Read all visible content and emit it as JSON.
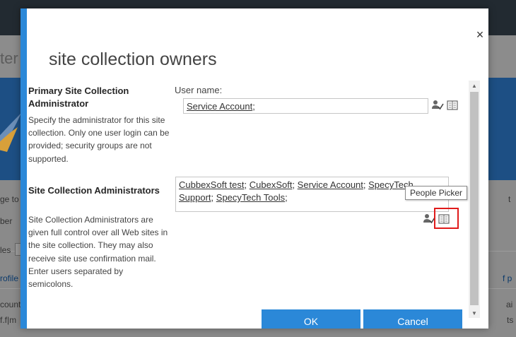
{
  "background": {
    "title_fragment": "ter",
    "fragments": [
      {
        "name": "bg-fragment-ge-to",
        "text": "ge to"
      },
      {
        "name": "bg-fragment-ber",
        "text": "ber"
      },
      {
        "name": "bg-fragment-les",
        "text": "les"
      },
      {
        "name": "bg-fragment-rofile",
        "text": "rofile"
      },
      {
        "name": "bg-fragment-ccount",
        "text": "count"
      },
      {
        "name": "bg-fragment-fm",
        "text": "f.f|m"
      },
      {
        "name": "bg-fragment-right-t",
        "text": "t"
      },
      {
        "name": "bg-fragment-right-p",
        "text": "f p"
      },
      {
        "name": "bg-fragment-right-ai",
        "text": "ai"
      },
      {
        "name": "bg-fragment-right-ts",
        "text": "ts"
      }
    ]
  },
  "dialog": {
    "title": "site collection owners",
    "close_glyph": "×",
    "primary": {
      "heading": "Primary Site Collection Administrator",
      "description": "Specify the administrator for this site collection. Only one user login can be provided; security groups are not supported.",
      "field_label": "User name:",
      "entities": [
        "Service Account"
      ]
    },
    "admins": {
      "heading": "Site Collection Administrators",
      "description": "Site Collection Administrators are given full control over all Web sites in the site collection. They may also receive site use confirmation mail. Enter users separated by semicolons.",
      "entities": [
        "CubbexSoft test",
        "CubexSoft",
        "Service Account",
        "SpecyTech Support",
        "SpecyTech Tools"
      ]
    },
    "tooltip": "People Picker",
    "buttons": {
      "ok": "OK",
      "cancel": "Cancel"
    },
    "icons": {
      "check_names": "check-names-icon",
      "browse": "address-book-icon",
      "highlight_color": "#e01b1b"
    },
    "colors": {
      "accent": "#2b88d8"
    }
  }
}
